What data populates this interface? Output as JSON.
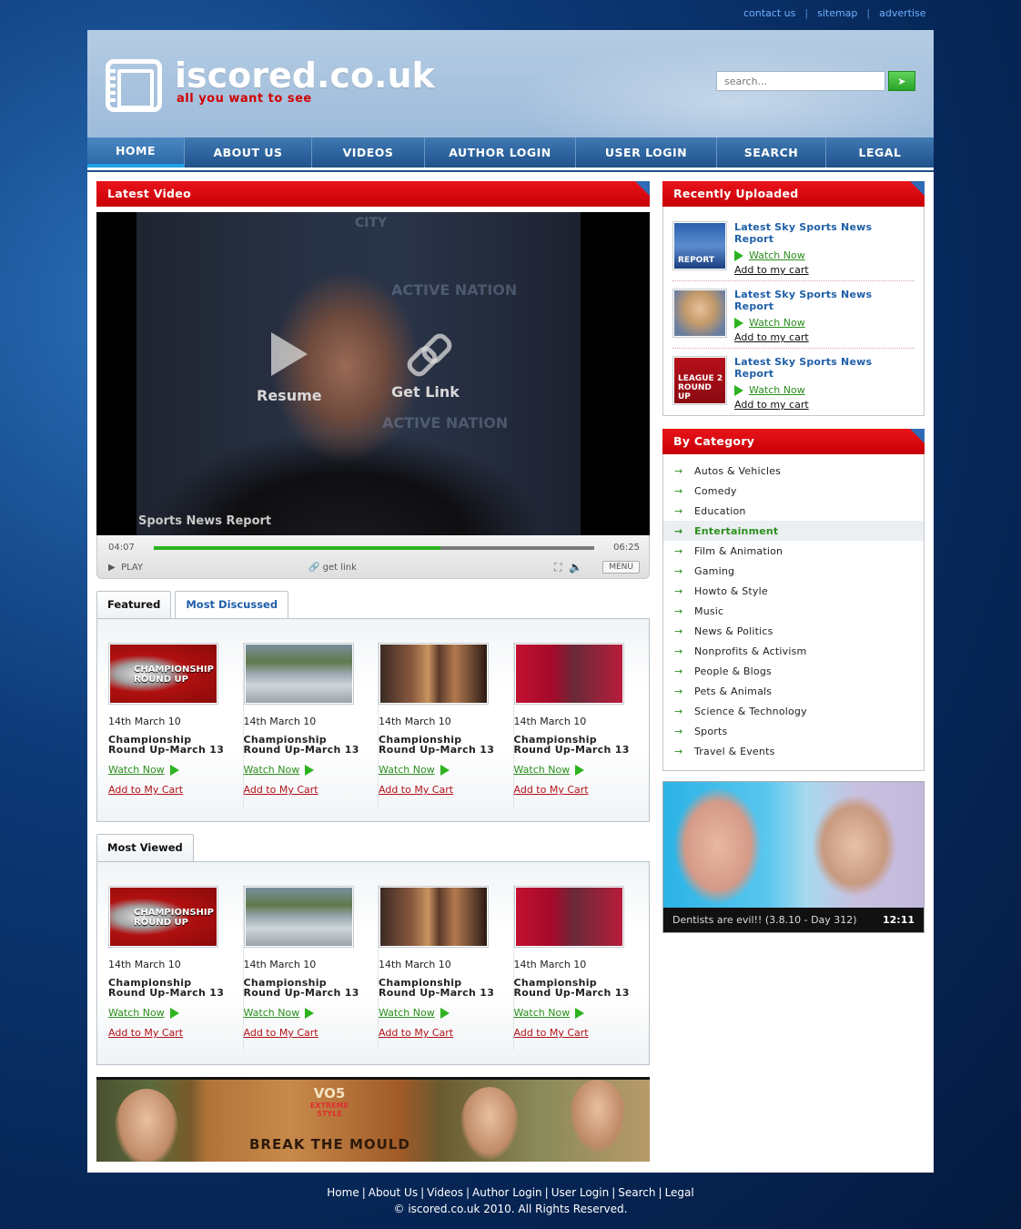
{
  "toplinks": [
    "contact us",
    "sitemap",
    "advertise"
  ],
  "logo": {
    "title": "iscored.co.uk",
    "tagline": "all you want to see"
  },
  "search": {
    "placeholder": "search..."
  },
  "nav": [
    {
      "label": "HOME",
      "active": true
    },
    {
      "label": "ABOUT US"
    },
    {
      "label": "VIDEOS"
    },
    {
      "label": "AUTHOR LOGIN"
    },
    {
      "label": "USER LOGIN"
    },
    {
      "label": "SEARCH"
    },
    {
      "label": "LEGAL"
    }
  ],
  "latest_video": {
    "heading": "Latest Video",
    "resume": "Resume",
    "get_link": "Get Link",
    "caption": "Sports News Report",
    "elapsed": "04:07",
    "duration": "06:25",
    "progress": 0.65,
    "play_label": "PLAY",
    "getlink_label": "get link",
    "menu_label": "MENU"
  },
  "featured": {
    "tabs": [
      "Featured",
      "Most Discussed"
    ],
    "items": [
      {
        "thumb": "championship-round-up",
        "thumb_text": "CHAMPIONSHIP ROUND UP",
        "date": "14th March 10",
        "title": "Championship Round Up-March 13",
        "watch": "Watch Now",
        "cart": "Add to My Cart"
      },
      {
        "thumb": "interview",
        "date": "14th March 10",
        "title": "Championship Round Up-March 13",
        "watch": "Watch Now",
        "cart": "Add to My Cart"
      },
      {
        "thumb": "boxing",
        "date": "14th March 10",
        "title": "Championship Round Up-March 13",
        "watch": "Watch Now",
        "cart": "Add to My Cart"
      },
      {
        "thumb": "cricket",
        "date": "14th March 10",
        "title": "Championship Round Up-March 13",
        "watch": "Watch Now",
        "cart": "Add to My Cart"
      }
    ]
  },
  "most_viewed": {
    "tab": "Most Viewed",
    "items": [
      {
        "thumb": "championship-round-up",
        "thumb_text": "CHAMPIONSHIP ROUND UP",
        "date": "14th March 10",
        "title": "Championship Round Up-March 13",
        "watch": "Watch Now",
        "cart": "Add to My Cart"
      },
      {
        "thumb": "interview",
        "date": "14th March 10",
        "title": "Championship Round Up-March 13",
        "watch": "Watch Now",
        "cart": "Add to My Cart"
      },
      {
        "thumb": "boxing",
        "date": "14th March 10",
        "title": "Championship Round Up-March 13",
        "watch": "Watch Now",
        "cart": "Add to My Cart"
      },
      {
        "thumb": "cricket",
        "date": "14th March 10",
        "title": "Championship Round Up-March 13",
        "watch": "Watch Now",
        "cart": "Add to My Cart"
      }
    ]
  },
  "banner": {
    "brand": "VO5",
    "subbrand": "EXTREME STYLE",
    "slogan": "BREAK THE MOULD"
  },
  "recent": {
    "heading": "Recently Uploaded",
    "items": [
      {
        "title": "Latest Sky Sports News Report",
        "watch": "Watch Now",
        "cart": "Add to my cart",
        "thumb_text": "REPORT"
      },
      {
        "title": "Latest Sky Sports News Report",
        "watch": "Watch Now",
        "cart": "Add to my cart"
      },
      {
        "title": "Latest Sky Sports News Report",
        "watch": "Watch Now",
        "cart": "Add to my cart",
        "thumb_text": "LEAGUE 2 ROUND UP"
      }
    ]
  },
  "categories": {
    "heading": "By Category",
    "items": [
      {
        "label": "Autos & Vehicles"
      },
      {
        "label": "Comedy"
      },
      {
        "label": "Education"
      },
      {
        "label": "Entertainment",
        "active": true
      },
      {
        "label": "Film & Animation"
      },
      {
        "label": "Gaming"
      },
      {
        "label": "Howto & Style"
      },
      {
        "label": "Music"
      },
      {
        "label": "News & Politics"
      },
      {
        "label": "Nonprofits & Activism"
      },
      {
        "label": "People & Blogs"
      },
      {
        "label": "Pets & Animals"
      },
      {
        "label": "Science & Technology"
      },
      {
        "label": "Sports"
      },
      {
        "label": "Travel & Events"
      }
    ]
  },
  "promo": {
    "title": "Dentists are evil!! (3.8.10 - Day 312)",
    "duration": "12:11"
  },
  "footer": {
    "links": [
      "Home",
      "About Us",
      "Videos",
      "Author Login",
      "User Login",
      "Search",
      "Legal"
    ],
    "copyright": "© iscored.co.uk 2010. All Rights Reserved."
  },
  "colors": {
    "accent_red": "#d40000",
    "nav_blue": "#2d639e",
    "link_green": "#2b8f1d",
    "link_blue": "#1f5fa8"
  }
}
